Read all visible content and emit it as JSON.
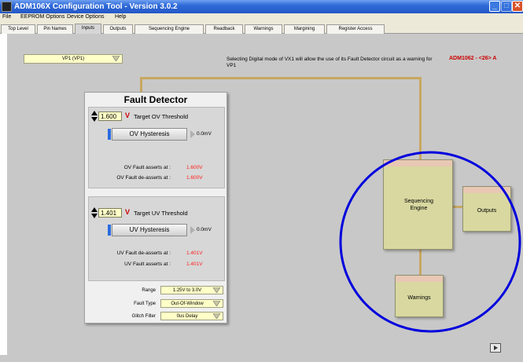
{
  "window": {
    "title": "ADM106X Configuration Tool - Version 3.0.2"
  },
  "menu": {
    "items": [
      "File",
      "EEPROM Options",
      "Device Options",
      "Help"
    ]
  },
  "tabs": [
    "Top Level",
    "Pin Names",
    "Inputs",
    "Outputs",
    "Sequencing Engine",
    "Readback",
    "Warnings",
    "Margining",
    "Register Access"
  ],
  "active_tab": "Inputs",
  "input_select": {
    "value": "VP1  (VP1)"
  },
  "info": {
    "message": "Selecting Digital mode of VX1 will allow the use of its Fault Detector circuit as a warning for VP1",
    "device": "ADM1062 - <26> A"
  },
  "fault_detector": {
    "title": "Fault Detector",
    "ov": {
      "value": "1.600",
      "unit": "V",
      "label": "Target OV Threshold",
      "hysteresis_label": "OV Hysteresis",
      "hysteresis_value": "0.0mV",
      "asserts_label": "OV Fault asserts at :",
      "asserts_value": "1.600V",
      "deasserts_label": "OV Fault de-asserts at :",
      "deasserts_value": "1.600V"
    },
    "uv": {
      "value": "1.401",
      "unit": "V",
      "label": "Target UV Threshold",
      "hysteresis_label": "UV Hysteresis",
      "hysteresis_value": "0.0mV",
      "deasserts_label": "UV Fault de-asserts at :",
      "deasserts_value": "1.401V",
      "asserts_label": "UV Fault asserts at :",
      "asserts_value": "1.401V"
    },
    "options": {
      "range_label": "Range",
      "range_value": "1.25V to 3.0V",
      "fault_type_label": "Fault Type",
      "fault_type_value": "Out-Of-Window",
      "glitch_label": "Glitch Filter",
      "glitch_value": "0us Delay"
    }
  },
  "blocks": {
    "sequencing": "Sequencing Engine",
    "outputs": "Outputs",
    "warnings": "Warnings"
  },
  "colors": {
    "titlebar": "#2458c8",
    "content_bg": "#c8c8c8",
    "block_fill": "#d8d8a0",
    "block_band": "#e8c8b4",
    "fault_value": "#ff2020",
    "highlight_ring": "#0000dd"
  }
}
